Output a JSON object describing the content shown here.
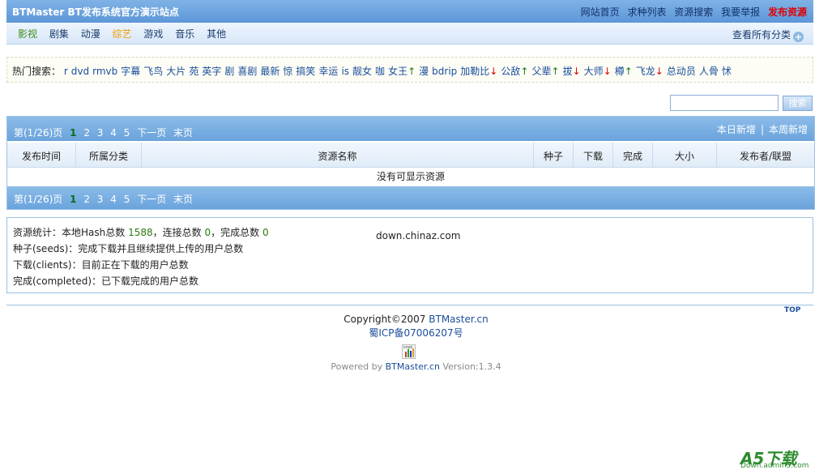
{
  "header": {
    "site_title": "BTMaster BT发布系统官方演示站点",
    "links": [
      "网站首页",
      "求种列表",
      "资源搜索",
      "我要举报"
    ],
    "publish_label": "发布资源"
  },
  "categories": {
    "items": [
      "影视",
      "剧集",
      "动漫",
      "综艺",
      "游戏",
      "音乐",
      "其他"
    ],
    "view_all": "查看所有分类"
  },
  "hot_search": {
    "label": "热门搜索：",
    "keywords": [
      {
        "t": "r",
        "d": ""
      },
      {
        "t": "dvd",
        "d": ""
      },
      {
        "t": "rmvb",
        "d": ""
      },
      {
        "t": "字幕",
        "d": ""
      },
      {
        "t": "飞鸟",
        "d": ""
      },
      {
        "t": "大片",
        "d": ""
      },
      {
        "t": "苑",
        "d": ""
      },
      {
        "t": "英字",
        "d": ""
      },
      {
        "t": "剧",
        "d": ""
      },
      {
        "t": "喜剧",
        "d": ""
      },
      {
        "t": "最新",
        "d": ""
      },
      {
        "t": "惊",
        "d": ""
      },
      {
        "t": "搞笑",
        "d": ""
      },
      {
        "t": "幸运",
        "d": ""
      },
      {
        "t": "is",
        "d": ""
      },
      {
        "t": "靓女",
        "d": ""
      },
      {
        "t": "咖",
        "d": ""
      },
      {
        "t": "女王",
        "d": "up"
      },
      {
        "t": "漫",
        "d": ""
      },
      {
        "t": "bdrip",
        "d": ""
      },
      {
        "t": "加勒比",
        "d": "down"
      },
      {
        "t": "公敌",
        "d": "up"
      },
      {
        "t": "父辈",
        "d": "up"
      },
      {
        "t": "拔",
        "d": "down"
      },
      {
        "t": "大师",
        "d": "down"
      },
      {
        "t": "樽",
        "d": "up"
      },
      {
        "t": "飞龙",
        "d": "down"
      },
      {
        "t": "总动员",
        "d": ""
      },
      {
        "t": "人骨",
        "d": ""
      },
      {
        "t": "怵",
        "d": ""
      }
    ]
  },
  "search": {
    "button_label": "搜索",
    "value": ""
  },
  "pager": {
    "page_info": "第(1/26)页",
    "pages": [
      "1",
      "2",
      "3",
      "4",
      "5"
    ],
    "current": "1",
    "next": "下一页",
    "last": "末页",
    "today_new": "本日新增",
    "week_new": "本周新增",
    "separator": "|"
  },
  "table": {
    "columns": [
      "发布时间",
      "所属分类",
      "资源名称",
      "种子",
      "下载",
      "完成",
      "大小",
      "发布者/联盟"
    ],
    "empty_text": "没有可显示资源"
  },
  "stats": {
    "line1_prefix": "资源统计：本地Hash总数",
    "hash_total": "1588",
    "conn_label": "，连接总数",
    "conn_total": "0",
    "done_label": "，完成总数",
    "done_total": "0",
    "seeds_desc": "种子(seeds)：完成下载并且继续提供上传的用户总数",
    "clients_desc": "下载(clients)：目前正在下载的用户总数",
    "completed_desc": "完成(completed)：已下载完成的用户总数",
    "watermark": "down.chinaz.com"
  },
  "footer": {
    "top_label": "TOP",
    "copyright_prefix": "Copyright©2007",
    "copyright_link": "BTMaster.cn",
    "icp": "蜀ICP备07006207号",
    "powered_prefix": "Powered by",
    "powered_link": "BTMaster.cn",
    "version": "Version:1.3.4",
    "chart_icon_text": "cnzz"
  },
  "watermark_logo": {
    "big": "A5下载",
    "sub": "Down.admin5.com"
  }
}
